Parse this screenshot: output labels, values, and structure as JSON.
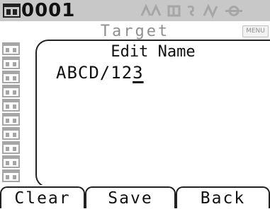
{
  "status": {
    "target_id": "0001",
    "status_icons": [
      "target-icon",
      "measurement-status-icons"
    ]
  },
  "header": {
    "title": "Target",
    "menu_label": "MENU"
  },
  "dialog": {
    "title": "Edit Name",
    "name_text_before_cursor": "ABCD/12",
    "name_text_cursor_char": "3"
  },
  "softkeys": {
    "clear": "Clear",
    "save": "Save",
    "back": "Back"
  },
  "colors": {
    "status_bg": "#c8c8c8",
    "title_text": "#8f8f8f",
    "text": "#111111"
  }
}
